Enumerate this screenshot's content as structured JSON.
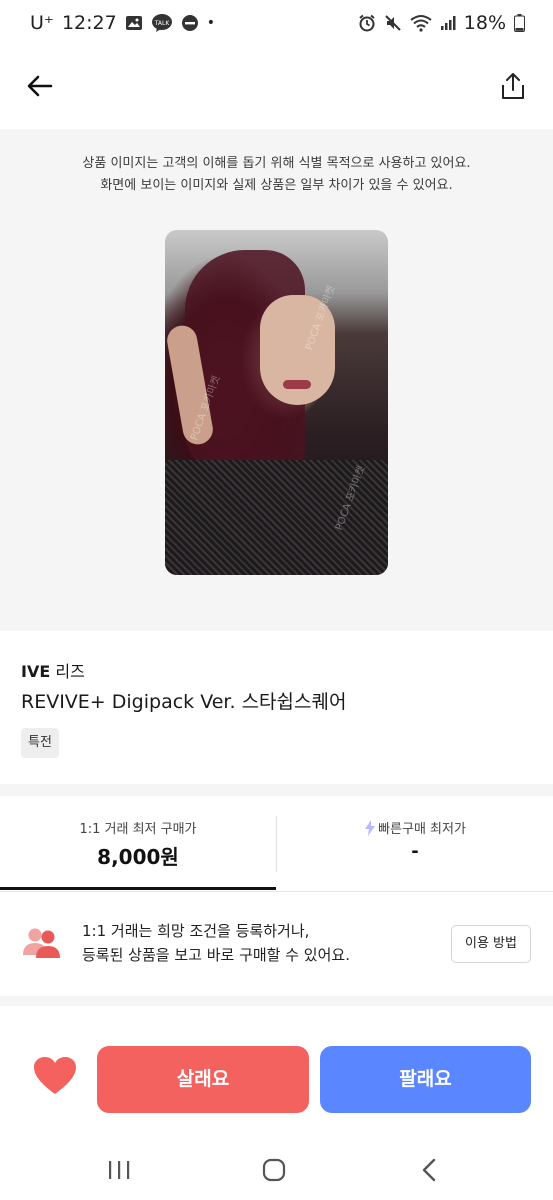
{
  "status_bar": {
    "carrier": "U⁺",
    "time": "12:27",
    "dot": "•",
    "battery": "18%",
    "talk_badge": "TALK"
  },
  "header": {
    "back_icon": "arrow-left-icon",
    "share_icon": "share-icon"
  },
  "image_area": {
    "notice_line1": "상품 이미지는 고객의 이해를 돕기 위해 식별 목적으로 사용하고 있어요.",
    "notice_line2": "화면에 보이는 이미지와 실제 상품은 일부 차이가 있을 수 있어요.",
    "watermark": "POCA 포카마켓"
  },
  "product": {
    "artist_group": "IVE",
    "artist_member": "리즈",
    "title": "REVIVE+ Digipack Ver. 스타쉽스퀘어",
    "tag": "특전"
  },
  "price_tabs": {
    "left_label": "1:1 거래 최저 구매가",
    "left_value": "8,000원",
    "right_label": "빠른구매 최저가",
    "right_value": "-",
    "active_tab": "left"
  },
  "info": {
    "line1": "1:1 거래는 희망 조건을 등록하거나,",
    "line2": "등록된 상품을 보고 바로 구매할 수 있어요.",
    "guide_button": "이용 방법"
  },
  "actions": {
    "buy_label": "살래요",
    "sell_label": "팔래요",
    "buy_color": "#f4625f",
    "sell_color": "#5a86ff",
    "heart_color": "#f4625f"
  }
}
